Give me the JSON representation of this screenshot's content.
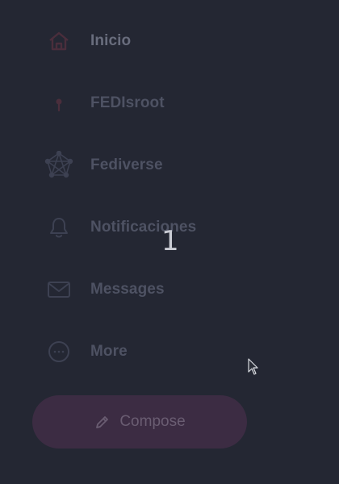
{
  "nav": {
    "items": [
      {
        "label": "Inicio",
        "icon": "home-icon",
        "active": true
      },
      {
        "label": "FEDIsroot",
        "icon": "pin-icon"
      },
      {
        "label": "Fediverse",
        "icon": "fediverse-icon"
      },
      {
        "label": "Notificaciones",
        "icon": "bell-icon"
      },
      {
        "label": "Messages",
        "icon": "envelope-icon"
      },
      {
        "label": "More",
        "icon": "more-circle-icon"
      }
    ]
  },
  "overlay": {
    "number": "1"
  },
  "compose": {
    "label": "Compose",
    "icon": "pencil-icon"
  },
  "colors": {
    "background": "#242733",
    "accent": "#3c2c43",
    "label": "#4e5263",
    "active_label": "#696d7d",
    "icon_muted": "#3a3e4d",
    "icon_accent": "#4a2e3c"
  }
}
